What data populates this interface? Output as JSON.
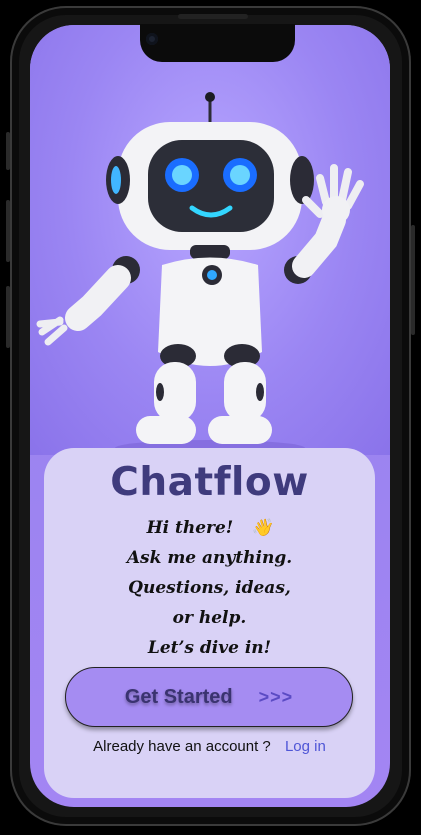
{
  "app": {
    "title": "Chatflow",
    "greeting_lines": [
      "Hi there!",
      "Ask me anything.",
      "Questions, ideas,",
      "or help.",
      "Let’s dive in!"
    ],
    "wave_emoji": "👋",
    "cta_label": "Get Started",
    "cta_arrows": ">>>",
    "account_prompt": "Already have an account ?",
    "login_label": "Log in"
  },
  "colors": {
    "screen_bg": "#a78ff5",
    "card_bg": "#d9d2f6",
    "title": "#3f3b7d",
    "cta_bg": "#a58cf2",
    "link": "#4f56d6"
  },
  "icons": {
    "hero": "robot-waving-illustration",
    "greeting": "waving-hand-icon"
  }
}
